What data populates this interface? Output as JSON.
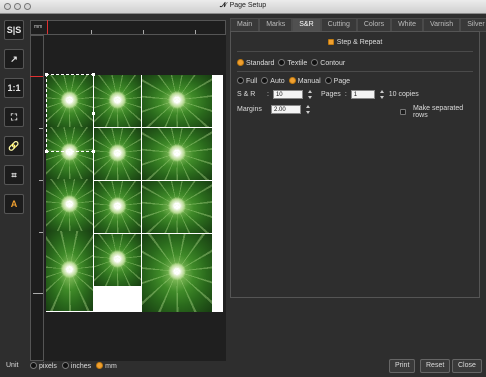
{
  "window": {
    "title": "Page Setup"
  },
  "toolbar": {
    "buttons": [
      {
        "name": "split-view-icon",
        "glyph": "S|S"
      },
      {
        "name": "export-icon",
        "glyph": "↗"
      },
      {
        "name": "actual-size-icon",
        "glyph": "1:1"
      },
      {
        "name": "fit-icon",
        "glyph": "⛶"
      },
      {
        "name": "link-icon",
        "glyph": "🔗"
      },
      {
        "name": "crop-marks-icon",
        "glyph": "⌗"
      },
      {
        "name": "text-icon",
        "glyph": "A"
      }
    ]
  },
  "ruler": {
    "unit": "mm"
  },
  "tabs": [
    "Main",
    "Marks",
    "S&R",
    "Cutting",
    "Colors",
    "White",
    "Varnish",
    "Silver"
  ],
  "active_tab": "S&R",
  "sr": {
    "section_title": "Step & Repeat",
    "mode_options": [
      "Standard",
      "Textile",
      "Contour"
    ],
    "type_options": [
      "Full",
      "Auto",
      "Manual",
      "Page"
    ],
    "sr_label": "S & R",
    "sr_sep": ":",
    "sr_value": "10",
    "pages_label": "Pages",
    "pages_sep": ":",
    "pages_value": "1",
    "copies_text": "10 copies",
    "margins_label": "Margins",
    "margins_value": "2.00",
    "separated_rows_label": "Make separated rows"
  },
  "bottom": {
    "unit_label": "Unit",
    "unit_options": [
      "pixels",
      "inches",
      "mm"
    ],
    "print": "Print",
    "reset": "Reset",
    "close": "Close"
  },
  "colors": {
    "accent": "#f0a030"
  }
}
